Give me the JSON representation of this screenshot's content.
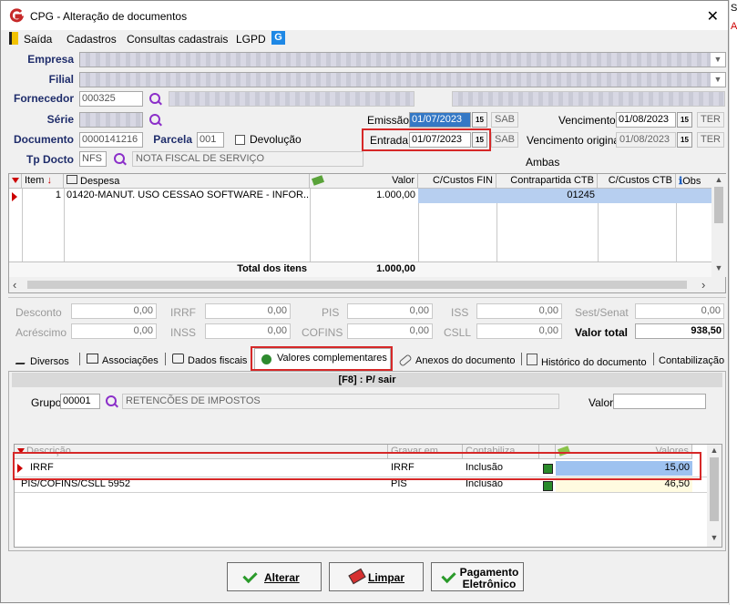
{
  "window": {
    "title": "CPG - Alteração de documentos",
    "close": "✕"
  },
  "bg_fragments": [
    "S",
    "A"
  ],
  "menu": [
    "Saída",
    "Cadastros",
    "Consultas cadastrais",
    "LGPD"
  ],
  "labels": {
    "empresa": "Empresa",
    "filial": "Filial",
    "fornecedor": "Fornecedor",
    "serie": "Série",
    "documento": "Documento",
    "parcela": "Parcela",
    "devolucao": "Devolução",
    "tp_docto": "Tp Docto",
    "emissao": "Emissão",
    "entrada": "Entrada",
    "vencimento": "Vencimento",
    "vencimento_original": "Vencimento original",
    "ambas": "Ambas"
  },
  "fields": {
    "fornecedor_code": "000325",
    "documento": "0000141216",
    "parcela": "001",
    "tp_docto_code": "NFS",
    "tp_docto_desc": "NOTA FISCAL DE SERVIÇO",
    "emissao": "01/07/2023",
    "emissao_day": "SAB",
    "entrada": "01/07/2023",
    "entrada_day": "SAB",
    "vencimento": "01/08/2023",
    "vencimento_day": "TER",
    "vencimento_original": "01/08/2023",
    "vencimento_original_day": "TER",
    "cal_icon": "15"
  },
  "items_grid": {
    "headers": [
      "Item",
      "Despesa",
      "Valor",
      "C/Custos FIN",
      "Contrapartida CTB",
      "C/Custos CTB",
      "Obs"
    ],
    "rows": [
      {
        "item": "1",
        "despesa": "01420-MANUT. USO CESSAO SOFTWARE - INFOR...",
        "valor": "1.000,00",
        "contrapartida": "01245"
      }
    ],
    "total_label": "Total dos itens",
    "total_value": "1.000,00"
  },
  "taxes": {
    "desconto": "Desconto",
    "acrescimo": "Acréscimo",
    "irrf": "IRRF",
    "inss": "INSS",
    "pis": "PIS",
    "cofins": "COFINS",
    "iss": "ISS",
    "csll": "CSLL",
    "sest": "Sest/Senat",
    "valor_total": "Valor total",
    "v_desconto": "0,00",
    "v_acrescimo": "0,00",
    "v_irrf": "0,00",
    "v_inss": "0,00",
    "v_pis": "0,00",
    "v_cofins": "0,00",
    "v_iss": "0,00",
    "v_csll": "0,00",
    "v_sest": "0,00",
    "v_total": "938,50"
  },
  "tabs": [
    "Diversos",
    "Associações",
    "Dados fiscais",
    "Valores complementares",
    "Anexos do documento",
    "Histórico do documento",
    "Contabilização"
  ],
  "panel": {
    "header": "[F8] : P/ sair",
    "grupo_label": "Grupo",
    "grupo_code": "00001",
    "grupo_desc": "RETENCÕES DE IMPOSTOS",
    "valor_label": "Valor"
  },
  "values_grid": {
    "headers": [
      "Descrição",
      "Gravar em",
      "Contabiliza",
      "Valores"
    ],
    "rows": [
      {
        "descricao": "IRRF",
        "gravar": "IRRF",
        "contabiliza": "Inclusão",
        "valor": "15,00"
      },
      {
        "descricao": "PIS/COFINS/CSLL 5952",
        "gravar": "PIS",
        "contabiliza": "Inclusão",
        "valor": "46,50"
      }
    ]
  },
  "buttons": {
    "alterar": "Alterar",
    "limpar": "Limpar",
    "pagamento_1": "Pagamento",
    "pagamento_2": "Eletrônico"
  },
  "colors": {
    "label_blue": "#1f2d6b",
    "highlight_red": "#d62828",
    "selection_blue": "#3478c5",
    "search_purple": "#8b2fc9"
  }
}
